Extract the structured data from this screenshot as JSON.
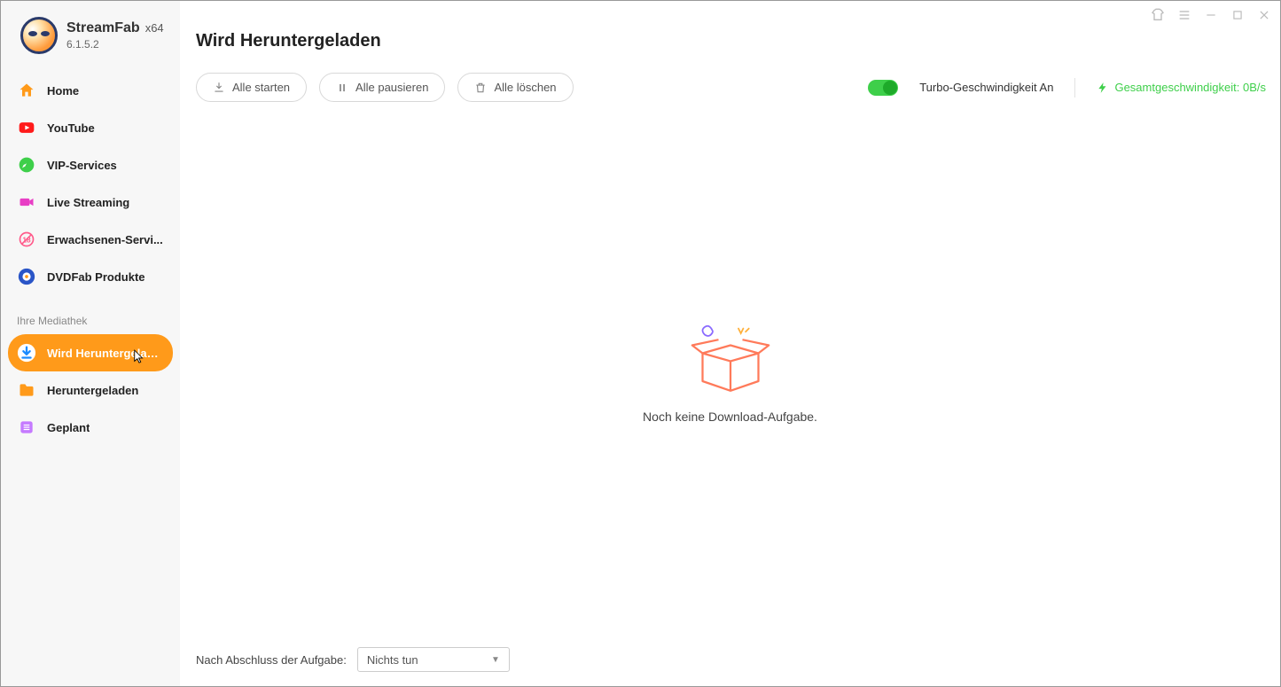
{
  "app": {
    "name": "StreamFab",
    "arch": "x64",
    "version": "6.1.5.2"
  },
  "nav": {
    "items": [
      {
        "label": "Home",
        "icon": "home"
      },
      {
        "label": "YouTube",
        "icon": "youtube"
      },
      {
        "label": "VIP-Services",
        "icon": "vip"
      },
      {
        "label": "Live Streaming",
        "icon": "camera"
      },
      {
        "label": "Erwachsenen-Servi...",
        "icon": "adult"
      },
      {
        "label": "DVDFab Produkte",
        "icon": "dvdfab"
      }
    ],
    "section_title": "Ihre Mediathek",
    "library": [
      {
        "label": "Wird Heruntergeladen",
        "icon": "download",
        "active": true
      },
      {
        "label": "Heruntergeladen",
        "icon": "folder"
      },
      {
        "label": "Geplant",
        "icon": "schedule"
      }
    ]
  },
  "page": {
    "title": "Wird Heruntergeladen",
    "buttons": {
      "start_all": "Alle starten",
      "pause_all": "Alle pausieren",
      "delete_all": "Alle löschen"
    },
    "turbo": {
      "on": true,
      "label": "Turbo-Geschwindigkeit An"
    },
    "speed_label": "Gesamtgeschwindigkeit: 0B/s",
    "empty_message": "Noch keine Download-Aufgabe.",
    "footer_label": "Nach Abschluss der Aufgabe:",
    "after_action_selected": "Nichts tun"
  }
}
